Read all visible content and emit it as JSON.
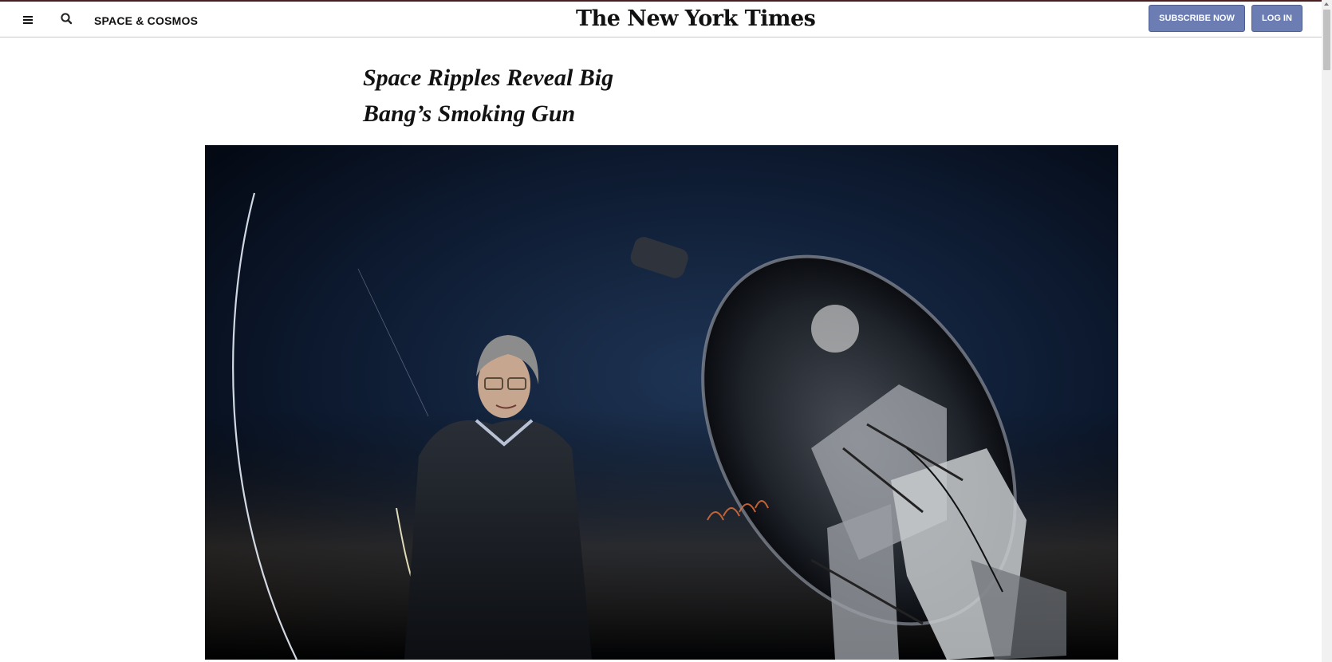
{
  "header": {
    "menu_icon": "hamburger-menu-icon",
    "search_icon": "search-icon",
    "section_label": "SPACE & COSMOS",
    "logo_text": "The New York Times",
    "subscribe_label": "SUBSCRIBE NOW",
    "login_label": "LOG IN",
    "button_color": "#6b7db3"
  },
  "article": {
    "headline": "Space Ripples Reveal Big Bang’s Smoking Gun"
  },
  "colors": {
    "top_rule": "#4a1e1e",
    "sky": "#07101e"
  }
}
